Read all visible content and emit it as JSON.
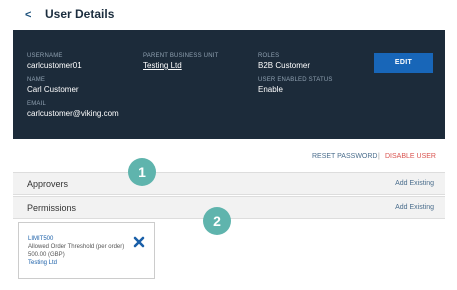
{
  "header": {
    "back_glyph": "<",
    "title": "User Details"
  },
  "details": {
    "username_label": "USERNAME",
    "username_value": "carlcustomer01",
    "name_label": "NAME",
    "name_value": "Carl Customer",
    "email_label": "EMAIL",
    "email_value": "carlcustomer@viking.com",
    "parent_bu_label": "PARENT BUSINESS UNIT",
    "parent_bu_value": "Testing Ltd",
    "roles_label": "ROLES",
    "roles_value": "B2B Customer",
    "status_label": "USER ENABLED STATUS",
    "status_value": "Enable",
    "edit_label": "EDIT"
  },
  "actions": {
    "reset_label": "RESET PASSWORD",
    "divider": "|",
    "disable_label": "DISABLE USER"
  },
  "sections": {
    "approvers_title": "Approvers",
    "approvers_add": "Add Existing",
    "permissions_title": "Permissions",
    "permissions_add": "Add Existing"
  },
  "permission_card": {
    "code": "LIMIT500",
    "description": "Allowed Order Threshold (per order)",
    "amount": "500.00   (GBP)",
    "unit": "Testing Ltd",
    "remove_icon": "close-x-icon"
  },
  "callouts": {
    "one": "1",
    "two": "2"
  },
  "colors": {
    "panel_bg": "#1c2b3a",
    "edit_button": "#1866b8",
    "disable_red": "#d9534f",
    "callout_teal": "#5fb4ad"
  }
}
